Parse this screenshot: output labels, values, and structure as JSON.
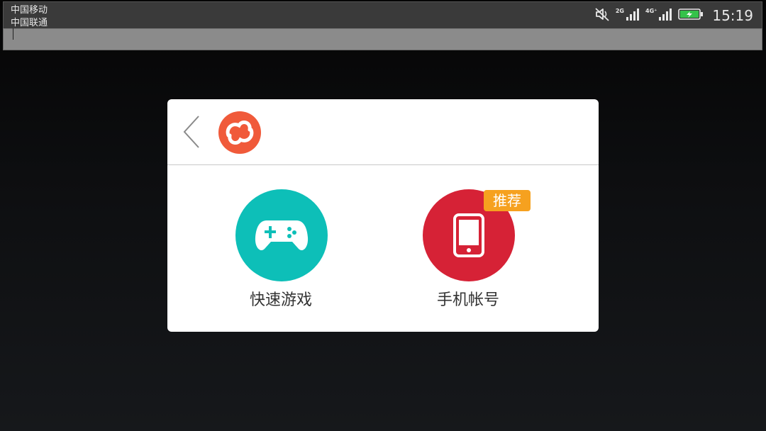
{
  "status_bar": {
    "carrier_1": "中国移动",
    "carrier_2": "中国联通",
    "network_1": "2G",
    "network_2": "4G⁺",
    "time": "15:19"
  },
  "dialog": {
    "header": {
      "back_icon": "chevron-left-icon",
      "logo_icon": "cloud-logo-icon",
      "logo_color": "#f05a3a"
    },
    "options": [
      {
        "label": "快速游戏",
        "icon": "gamepad-icon",
        "color": "#0dbfb8"
      },
      {
        "label": "手机帐号",
        "icon": "mobile-phone-icon",
        "color": "#d62236",
        "badge": "推荐",
        "badge_color": "#f6a11f"
      }
    ]
  }
}
